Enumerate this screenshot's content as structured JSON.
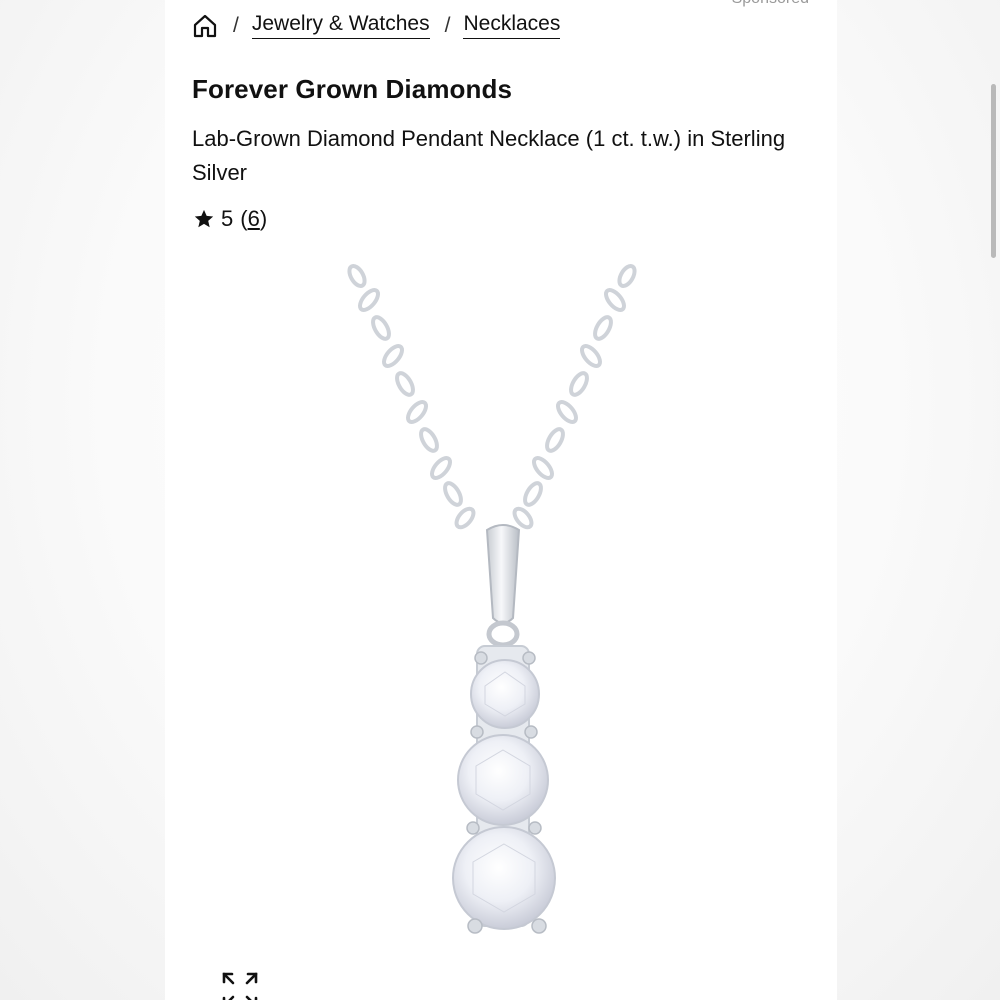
{
  "header": {
    "sponsored_label": "Sponsored"
  },
  "breadcrumb": {
    "home_icon": "home-icon",
    "separator": "/",
    "items": [
      {
        "label": "Jewelry & Watches"
      },
      {
        "label": "Necklaces"
      }
    ]
  },
  "product": {
    "brand": "Forever Grown Diamonds",
    "title": "Lab-Grown Diamond Pendant Necklace (1 ct. t.w.) in Sterling Silver",
    "rating": {
      "icon": "star-icon",
      "value": "5",
      "open_paren": "(",
      "count": "6",
      "close_paren": ")"
    },
    "image_icon": "necklace-pendant-image",
    "expand_icon": "expand-icon"
  },
  "colors": {
    "text": "#111111",
    "sponsored": "#9a9a9a",
    "metal": "#d9dde2",
    "scrollbar": "#b9b9b9"
  }
}
